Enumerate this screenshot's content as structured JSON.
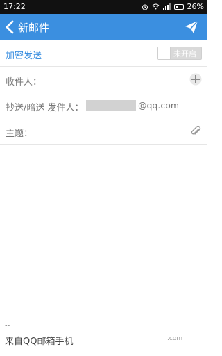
{
  "status_bar": {
    "time": "17:22",
    "battery": "26%",
    "icons": [
      "alarm-icon",
      "wifi-icon",
      "signal-icon",
      "battery-icon"
    ]
  },
  "app_bar": {
    "title": "新邮件",
    "back_icon": "back-chevron-icon",
    "send_icon": "send-paper-plane-icon"
  },
  "encryption": {
    "label": "加密发送",
    "toggle_state": "未开启"
  },
  "fields": {
    "to_label": "收件人：",
    "cc_label": "抄送/暗送 发件人：",
    "sender_suffix": "@qq.com",
    "subject_label": "主题："
  },
  "signature": {
    "separator": "--",
    "partial_line": "来自QQ邮箱手机",
    "partial_tail": ".com"
  },
  "colors": {
    "accent": "#3b8fe0",
    "status_bar": "#111111"
  }
}
